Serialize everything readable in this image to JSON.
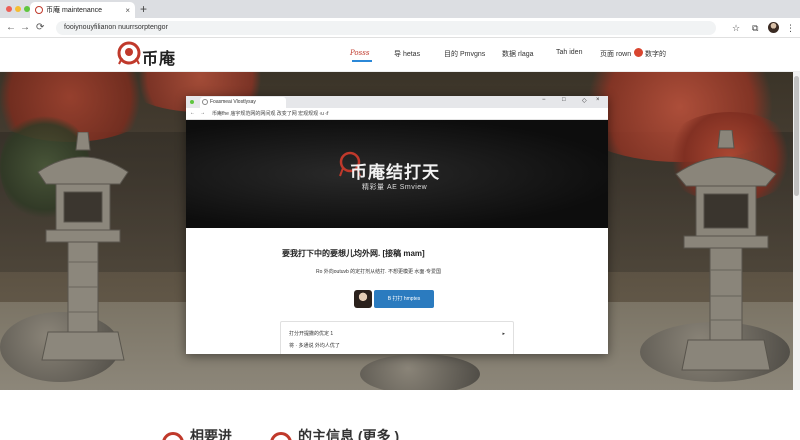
{
  "browser": {
    "tab_title": "币庵 maintenance",
    "tab_close": "×",
    "new_tab": "+",
    "url": "fooiynouyfilianon nuurrsorptengor",
    "icons": [
      "back-arrow-icon",
      "forward-arrow-icon",
      "reload-icon",
      "star-icon",
      "extensions-icon",
      "profile-avatar",
      "menu-dots-icon"
    ],
    "traffic_colors": [
      "#ec5f57",
      "#f5bd33",
      "#5fc63f"
    ]
  },
  "site": {
    "brand": "币庵",
    "brand_color": "#c0392b",
    "accent_color": "#2b88d8",
    "nav": [
      {
        "label": "Posss",
        "active": true
      },
      {
        "label": "导 hetas"
      },
      {
        "label": "目的 Pmvgns"
      },
      {
        "label": "数据 rlaga"
      },
      {
        "label": "Tah iden"
      },
      {
        "label": "页面 rown"
      },
      {
        "label": "数字的"
      }
    ]
  },
  "screenshot": {
    "tab_title": "Foasmeai Vlostlysay",
    "url": "币庵fhe 庙宇规范网的网间观 改变了网 宏观规观 ‹u ‹f",
    "hero_title": "币庵结打天",
    "hero_sub": "精彩量 AE Smview",
    "heading": "要我打下中的要想儿均外网. [接稿 mam]",
    "paragraph": "Ro 外向outuvb 的定打剂从结打. 不想更模更 水面·专爱国",
    "button_label": "B 打打 hmptes",
    "card_line1": "打分开提撒的优定 1",
    "card_line2": "将 · 多通说 外均人优了",
    "card_arrow": "▸"
  },
  "below_fold": {
    "item1": "相要进",
    "item2": "的主信息 (更多 )"
  }
}
